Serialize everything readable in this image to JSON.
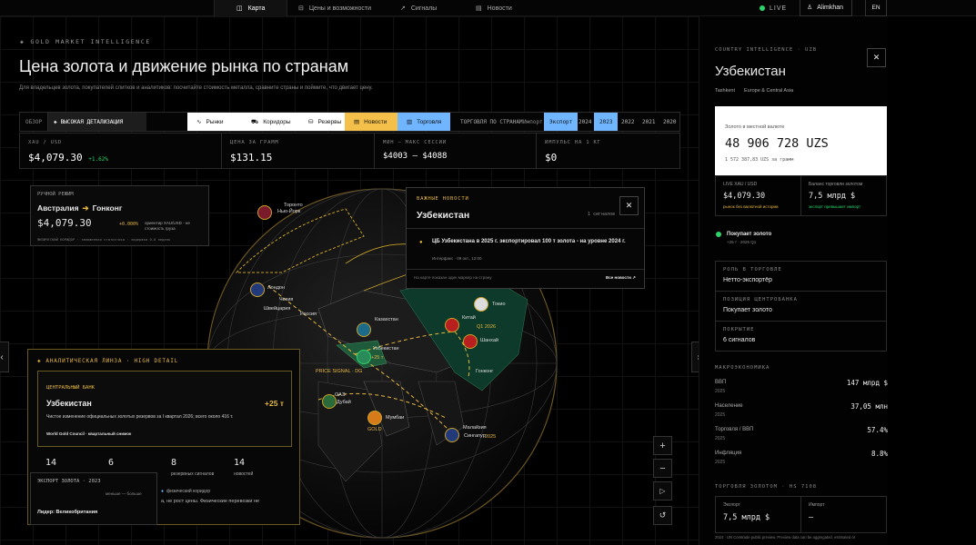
{
  "nav": {
    "tabs": [
      "Карта",
      "Цены и возможности",
      "Сигналы",
      "Новости"
    ],
    "live": "LIVE",
    "user": "Alimkhan",
    "lang": "EN"
  },
  "header": {
    "eyebrow": "GOLD MARKET INTELLIGENCE",
    "title": "Цена золота и движение рынка по странам",
    "subtitle": "Для владельцев золота, покупателей слитков и аналитиков: посчитайте стоимость металла, сравните страны и поймите, что двигает цену."
  },
  "controls": {
    "overview": "ОБЗОР",
    "detail": "ВЫСОКАЯ ДЕТАЛИЗАЦИЯ",
    "layers": [
      "Рынки",
      "Коридоры",
      "Резервы",
      "Новости",
      "Торговля"
    ],
    "trade_label": "ТОРГОВЛЯ ПО СТРАНАМ",
    "import": "Импорт",
    "export": "Экспорт",
    "years": [
      "2024",
      "2023",
      "2022",
      "2021",
      "2020"
    ]
  },
  "stats": [
    {
      "label": "XAU / USD",
      "value": "$4,079.30",
      "change": "+1.62%"
    },
    {
      "label": "ЦЕНА ЗА ГРАММ",
      "value": "$131.15"
    },
    {
      "label": "МИН – МАКС СЕССИИ",
      "value": "$4003 – $4088"
    },
    {
      "label": "ИМПУЛЬС НА 1 КГ",
      "value": "$0"
    }
  ],
  "manual": {
    "label": "РУЧНОЙ РЕЖИМ",
    "route_from": "Австралия",
    "route_to": "Гонконг",
    "price": "$4,079.30",
    "change": "+0.000%",
    "note": "ориентир XAU/USD · не стоимость груза",
    "footer": "ФИЗИЧЕСКИЙ КОРИДОР · таможенная статистика · задержка 0-0 недель"
  },
  "news_card": {
    "label": "ВАЖНЫЕ НОВОСТИ",
    "country": "Узбекистан",
    "count": "1 сигналов",
    "headline": "ЦБ Узбекистана в 2025 г. экспортировал 100 т золота - на уровне 2024 г.",
    "meta": "Интерфакс · 09 окт., 12:00",
    "hint": "На карте показан один маркер на страну",
    "all": "Все новости ↗"
  },
  "lens": {
    "title": "АНАЛИТИЧЕСКАЯ ЛИНЗА · HIGH DETAIL",
    "inner_label": "ЦЕНТРАЛЬНЫЙ БАНК",
    "country": "Узбекистан",
    "delta": "+25 т",
    "text": "Чистое изменение официальных золотых резервов за I квартал 2026; всего около 416 т.",
    "source": "World Gold Council · квартальный снимок",
    "counts": [
      {
        "n": "14",
        "l": ""
      },
      {
        "n": "6",
        "l": ""
      },
      {
        "n": "8",
        "l": "резервных сигналов"
      },
      {
        "n": "14",
        "l": "новостей"
      }
    ],
    "legend": "физический коридор",
    "tail": "а, не рост цены. Физические перевозки не"
  },
  "export_card": {
    "title": "ЭКСПОРТ ЗОЛОТА · 2023",
    "scale": "меньше — больше",
    "leader": "Лидер: Великобритания"
  },
  "map": {
    "cities": [
      "Торонто",
      "Нью-Йорк",
      "Лондон",
      "Чехия",
      "Швейцария",
      "Россия",
      "Казахстан",
      "Узбекистан",
      "Китай",
      "Токио",
      "Шанхай",
      "Гонконг",
      "ОАЭ",
      "Дубай",
      "Мумбаи",
      "Малайзия",
      "Сингапур",
      "PRICE SIGNAL · DG"
    ],
    "labels_gold": [
      "Q1 2026",
      "2024",
      "2025",
      "2026",
      "GOLD",
      "+25 т"
    ]
  },
  "right": {
    "eyebrow": "COUNTRY INTELLIGENCE · UZB",
    "country": "Узбекистан",
    "capital": "Tashkent",
    "region": "Europe & Central Asia",
    "local_label": "Золото в местной валюте",
    "local_value": "48 906 728 UZS",
    "per_gram": "1 572 387,83 UZS за грамм",
    "live_label": "LIVE XAU / USD",
    "live_value": "$4,079.30",
    "live_note": "рынок без валютной истории",
    "balance_label": "Баланс торговли золотом",
    "balance_value": "7,5 млрд $",
    "balance_note": "экспорт превышает импорт",
    "status": "Покупает золото",
    "status_meta": "+25 т · 2026 Q1",
    "role_label": "РОЛЬ В ТОРГОВЛЕ",
    "role": "Нетто-экспортёр",
    "cb_label": "ПОЗИЦИЯ ЦЕНТРОБАНКА",
    "cb": "Покупает золото",
    "cover_label": "ПОКРЫТИЕ",
    "cover": "6 сигналов",
    "macro_label": "МАКРОЭКОНОМИКА",
    "macro": [
      {
        "k": "ВВП",
        "y": "2025",
        "v": "147 млрд $"
      },
      {
        "k": "Население",
        "y": "2025",
        "v": "37,05 млн"
      },
      {
        "k": "Торговля / ВВП",
        "y": "2025",
        "v": "57.4%"
      },
      {
        "k": "Инфляция",
        "y": "2025",
        "v": "8.8%"
      }
    ],
    "trade_label": "ТОРГОВЛЯ ЗОЛОТОМ · HS 7108",
    "export_label": "Экспорт",
    "export_value": "7,5 млрд $",
    "import_label": "Импорт",
    "import_value": "—",
    "footnote": "2024 · UN Comtrade public preview. Preview data can be aggregated, estimated or"
  },
  "colors": {
    "gold": "#e7b73e",
    "accent_blue": "#6fb5ff",
    "accent_yellow": "#f5c04a",
    "live_green": "#2bd46b"
  }
}
